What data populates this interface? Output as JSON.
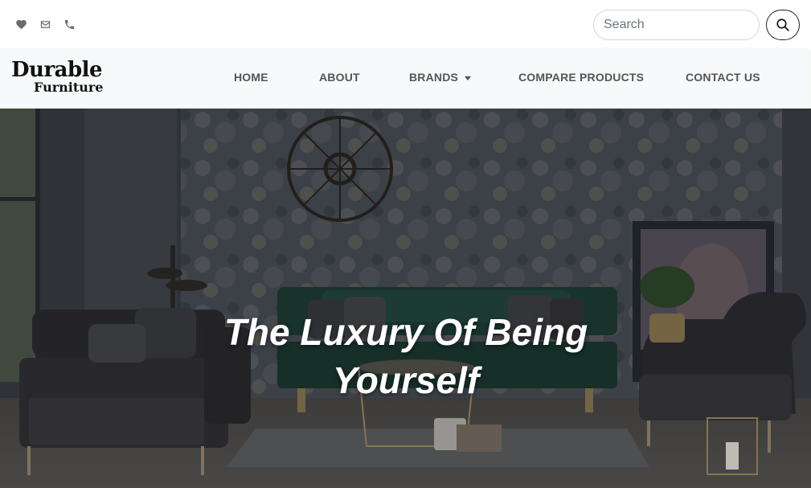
{
  "topbar": {
    "icons": [
      "heart-icon",
      "mail-icon",
      "phone-icon"
    ],
    "search": {
      "placeholder": "Search",
      "value": ""
    },
    "search_button_icon": "search-icon"
  },
  "brand": {
    "line1": "Durable",
    "line2": "Furniture"
  },
  "nav": {
    "items": [
      {
        "label": "HOME"
      },
      {
        "label": "ABOUT"
      },
      {
        "label": "BRANDS",
        "dropdown": true
      },
      {
        "label": "COMPARE PRODUCTS"
      },
      {
        "label": "CONTACT US"
      }
    ]
  },
  "hero": {
    "title_line1": "The Luxury Of Being",
    "title_line2": "Yourself"
  },
  "colors": {
    "navbar_bg": "#f8f9fa",
    "nav_text": "#555555",
    "hero_overlay": "#2f3238",
    "sofa_green": "#1f4a3e"
  }
}
